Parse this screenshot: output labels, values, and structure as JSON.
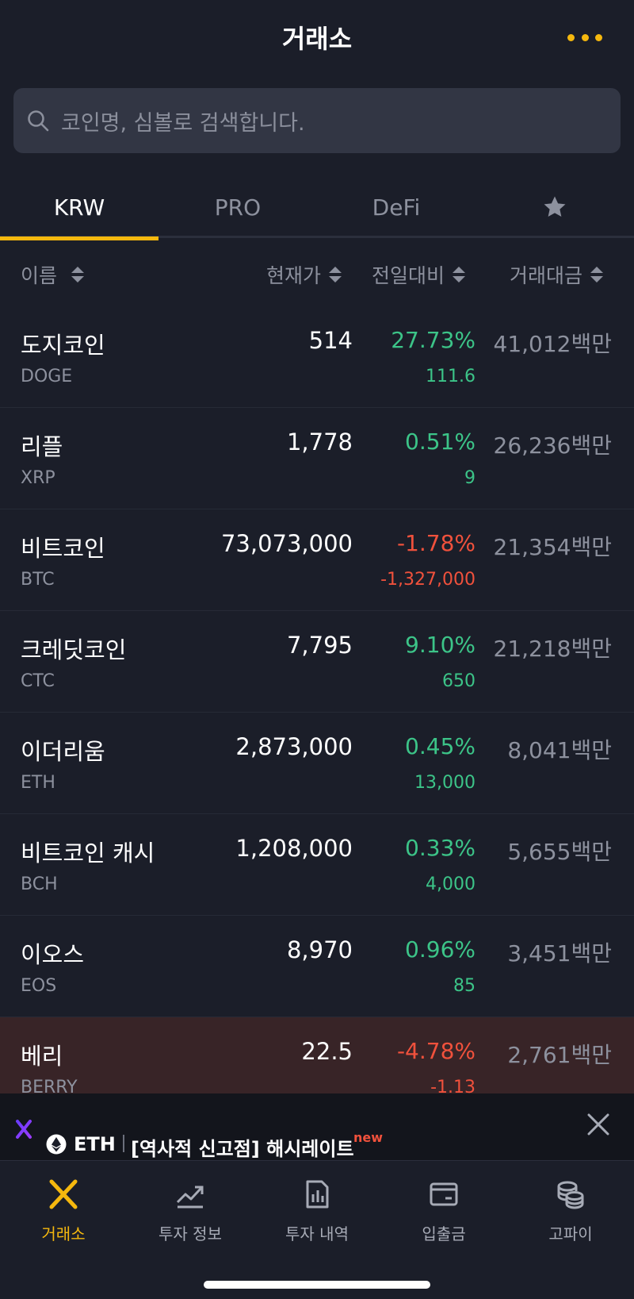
{
  "header": {
    "title": "거래소"
  },
  "search": {
    "placeholder": "코인명, 심볼로 검색합니다."
  },
  "tabs": [
    {
      "label": "KRW",
      "active": true
    },
    {
      "label": "PRO",
      "active": false
    },
    {
      "label": "DeFi",
      "active": false
    },
    {
      "icon": "star-icon",
      "active": false
    }
  ],
  "columns": {
    "name": "이름",
    "price": "현재가",
    "change": "전일대비",
    "volume": "거래대금"
  },
  "coins": [
    {
      "name": "도지코인",
      "symbol": "DOGE",
      "price": "514",
      "pct": "27.73%",
      "change": "111.6",
      "volume": "41,012백만",
      "direction": "up"
    },
    {
      "name": "리플",
      "symbol": "XRP",
      "price": "1,778",
      "pct": "0.51%",
      "change": "9",
      "volume": "26,236백만",
      "direction": "up"
    },
    {
      "name": "비트코인",
      "symbol": "BTC",
      "price": "73,073,000",
      "pct": "-1.78%",
      "change": "-1,327,000",
      "volume": "21,354백만",
      "direction": "down"
    },
    {
      "name": "크레딧코인",
      "symbol": "CTC",
      "price": "7,795",
      "pct": "9.10%",
      "change": "650",
      "volume": "21,218백만",
      "direction": "up"
    },
    {
      "name": "이더리움",
      "symbol": "ETH",
      "price": "2,873,000",
      "pct": "0.45%",
      "change": "13,000",
      "volume": "8,041백만",
      "direction": "up"
    },
    {
      "name": "비트코인 캐시",
      "symbol": "BCH",
      "price": "1,208,000",
      "pct": "0.33%",
      "change": "4,000",
      "volume": "5,655백만",
      "direction": "up"
    },
    {
      "name": "이오스",
      "symbol": "EOS",
      "price": "8,970",
      "pct": "0.96%",
      "change": "85",
      "volume": "3,451백만",
      "direction": "up"
    },
    {
      "name": "베리",
      "symbol": "BERRY",
      "price": "22.5",
      "pct": "-4.78%",
      "change": "-1.13",
      "volume": "2,761백만",
      "direction": "down"
    }
  ],
  "banner": {
    "coin": "ETH",
    "message": "[역사적 신고점] 해시레이트",
    "badge": "new"
  },
  "nav": [
    {
      "label": "거래소",
      "icon": "exchange-icon",
      "active": true
    },
    {
      "label": "투자 정보",
      "icon": "chart-trend-icon",
      "active": false
    },
    {
      "label": "투자 내역",
      "icon": "report-icon",
      "active": false
    },
    {
      "label": "입출금",
      "icon": "wallet-icon",
      "active": false
    },
    {
      "label": "고파이",
      "icon": "coins-icon",
      "active": false
    }
  ],
  "colors": {
    "background": "#1b1e29",
    "accent": "#f5b80e",
    "up": "#3cc488",
    "down": "#f0513c",
    "muted": "#8d919e"
  }
}
